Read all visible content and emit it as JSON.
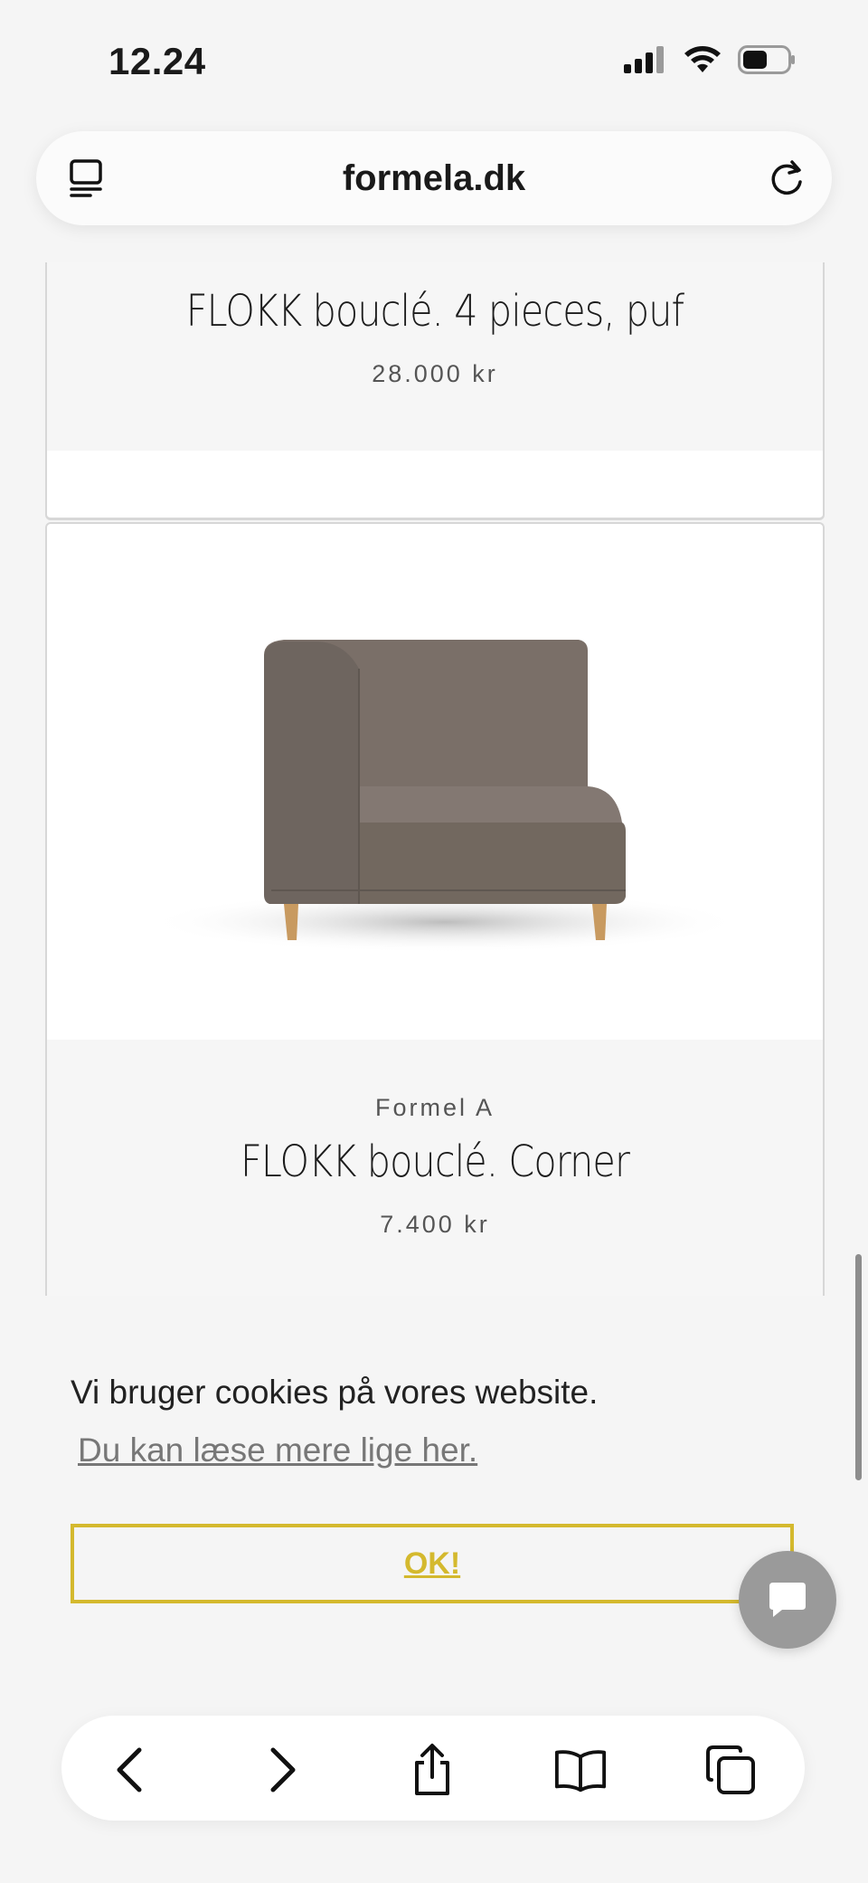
{
  "status_bar": {
    "time": "12.24"
  },
  "browser": {
    "url": "formela.dk"
  },
  "products": [
    {
      "title": "FLOKK bouclé. 4 pieces, puf",
      "price": "28.000 kr"
    },
    {
      "brand": "Formel A",
      "title": "FLOKK bouclé. Corner",
      "price": "7.400 kr",
      "image": "corner-sofa-module"
    }
  ],
  "cookie_banner": {
    "text": "Vi bruger cookies på vores website.",
    "link": "Du kan læse mere lige her.",
    "ok_label": "OK!"
  },
  "colors": {
    "accent": "#d4b92e",
    "background": "#f5f5f5"
  },
  "icons": [
    "tabs-icon",
    "reload-icon",
    "back-icon",
    "forward-icon",
    "share-icon",
    "bookmarks-icon",
    "tabs-overview-icon",
    "chat-icon"
  ]
}
